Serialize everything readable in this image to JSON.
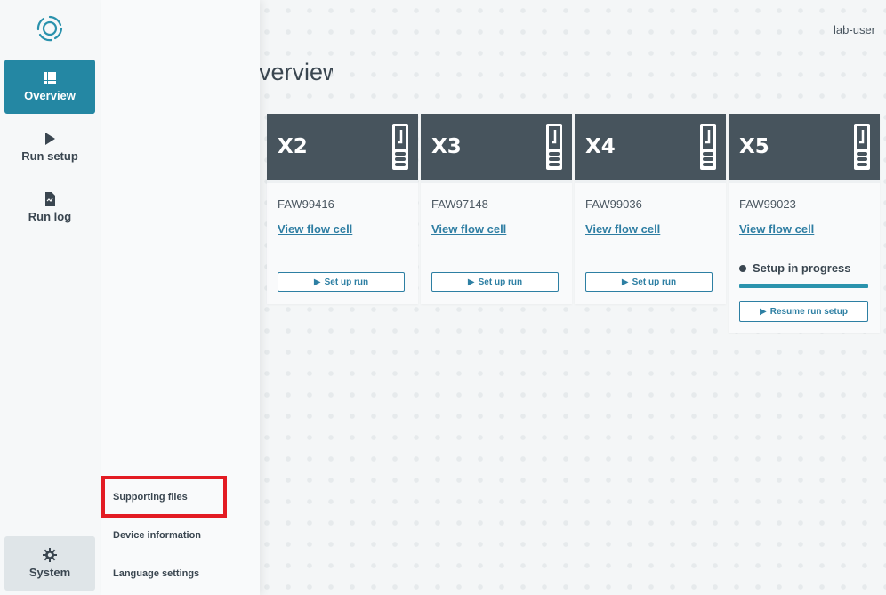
{
  "header": {
    "user": "lab-user",
    "title": "Overview"
  },
  "nav": {
    "items": [
      {
        "label": "Overview",
        "icon": "grid-icon"
      },
      {
        "label": "Run setup",
        "icon": "play-icon"
      },
      {
        "label": "Run log",
        "icon": "document-icon"
      }
    ],
    "system": {
      "label": "System",
      "icon": "gear-icon"
    }
  },
  "flyout": {
    "items": [
      "Supporting files",
      "Device information",
      "Language settings"
    ]
  },
  "cards": [
    {
      "label": "X2",
      "serial": "FAW99416",
      "link": "View flow cell",
      "button": "Set up run"
    },
    {
      "label": "X3",
      "serial": "FAW97148",
      "link": "View flow cell",
      "button": "Set up run"
    },
    {
      "label": "X4",
      "serial": "FAW99036",
      "link": "View flow cell",
      "button": "Set up run"
    },
    {
      "label": "X5",
      "serial": "FAW99023",
      "link": "View flow cell",
      "status": "Setup in progress",
      "progress": 1.0,
      "button": "Resume run setup"
    }
  ],
  "colors": {
    "accent": "#2487a3",
    "card_header": "#47545d",
    "link": "#2f7ea3",
    "highlight": "#e31b23"
  }
}
